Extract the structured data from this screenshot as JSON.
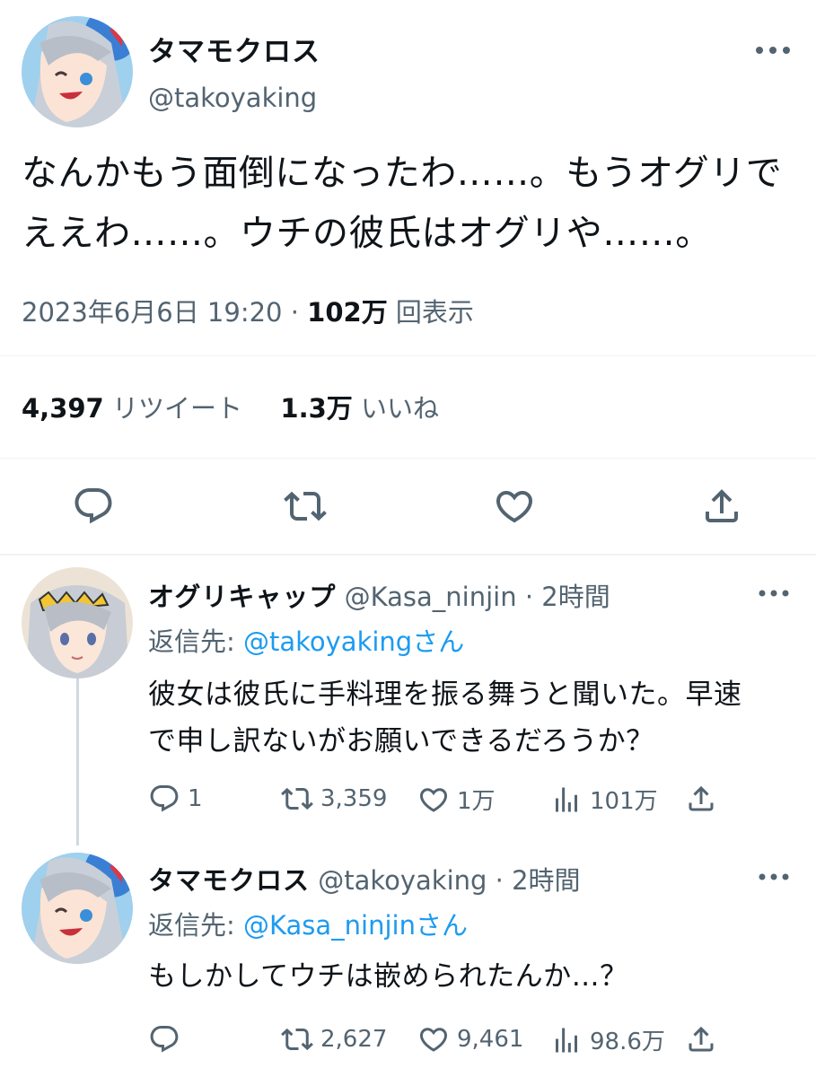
{
  "main_tweet": {
    "display_name": "タマモクロス",
    "handle": "@takoyaking",
    "text_line1": "なんかもう面倒になったわ……。もうオグリで",
    "text_line2": "ええわ……。ウチの彼氏はオグリや……。",
    "timestamp": "2023年6月6日 19:20",
    "separator": "·",
    "views_count": "102万",
    "views_label": "回表示",
    "retweets_count": "4,397",
    "retweets_label": "リツイート",
    "likes_count": "1.3万",
    "likes_label": "いいね"
  },
  "replies": [
    {
      "display_name": "オグリキャップ",
      "handle": "@Kasa_ninjin",
      "time": "· 2時間",
      "reply_to_label": "返信先:",
      "reply_to_handle": "@takoyakingさん",
      "text_line1": "彼女は彼氏に手料理を振る舞うと聞いた。早速",
      "text_line2": "で申し訳ないがお願いできるだろうか？",
      "reply_count": "1",
      "retweet_count": "3,359",
      "like_count": "1万",
      "view_count": "101万"
    },
    {
      "display_name": "タマモクロス",
      "handle": "@takoyaking",
      "time": "· 2時間",
      "reply_to_label": "返信先:",
      "reply_to_handle": "@Kasa_ninjinさん",
      "text_line1": "もしかしてウチは嵌められたんか…？",
      "reply_count": "",
      "retweet_count": "2,627",
      "like_count": "9,461",
      "view_count": "98.6万"
    }
  ],
  "icons": [
    "reply-icon",
    "retweet-icon",
    "like-icon",
    "share-icon",
    "views-icon",
    "more-icon"
  ],
  "colors": {
    "text": "#0f1419",
    "secondary": "#536471",
    "link": "#1d9bf0",
    "divider": "#eff3f4"
  }
}
